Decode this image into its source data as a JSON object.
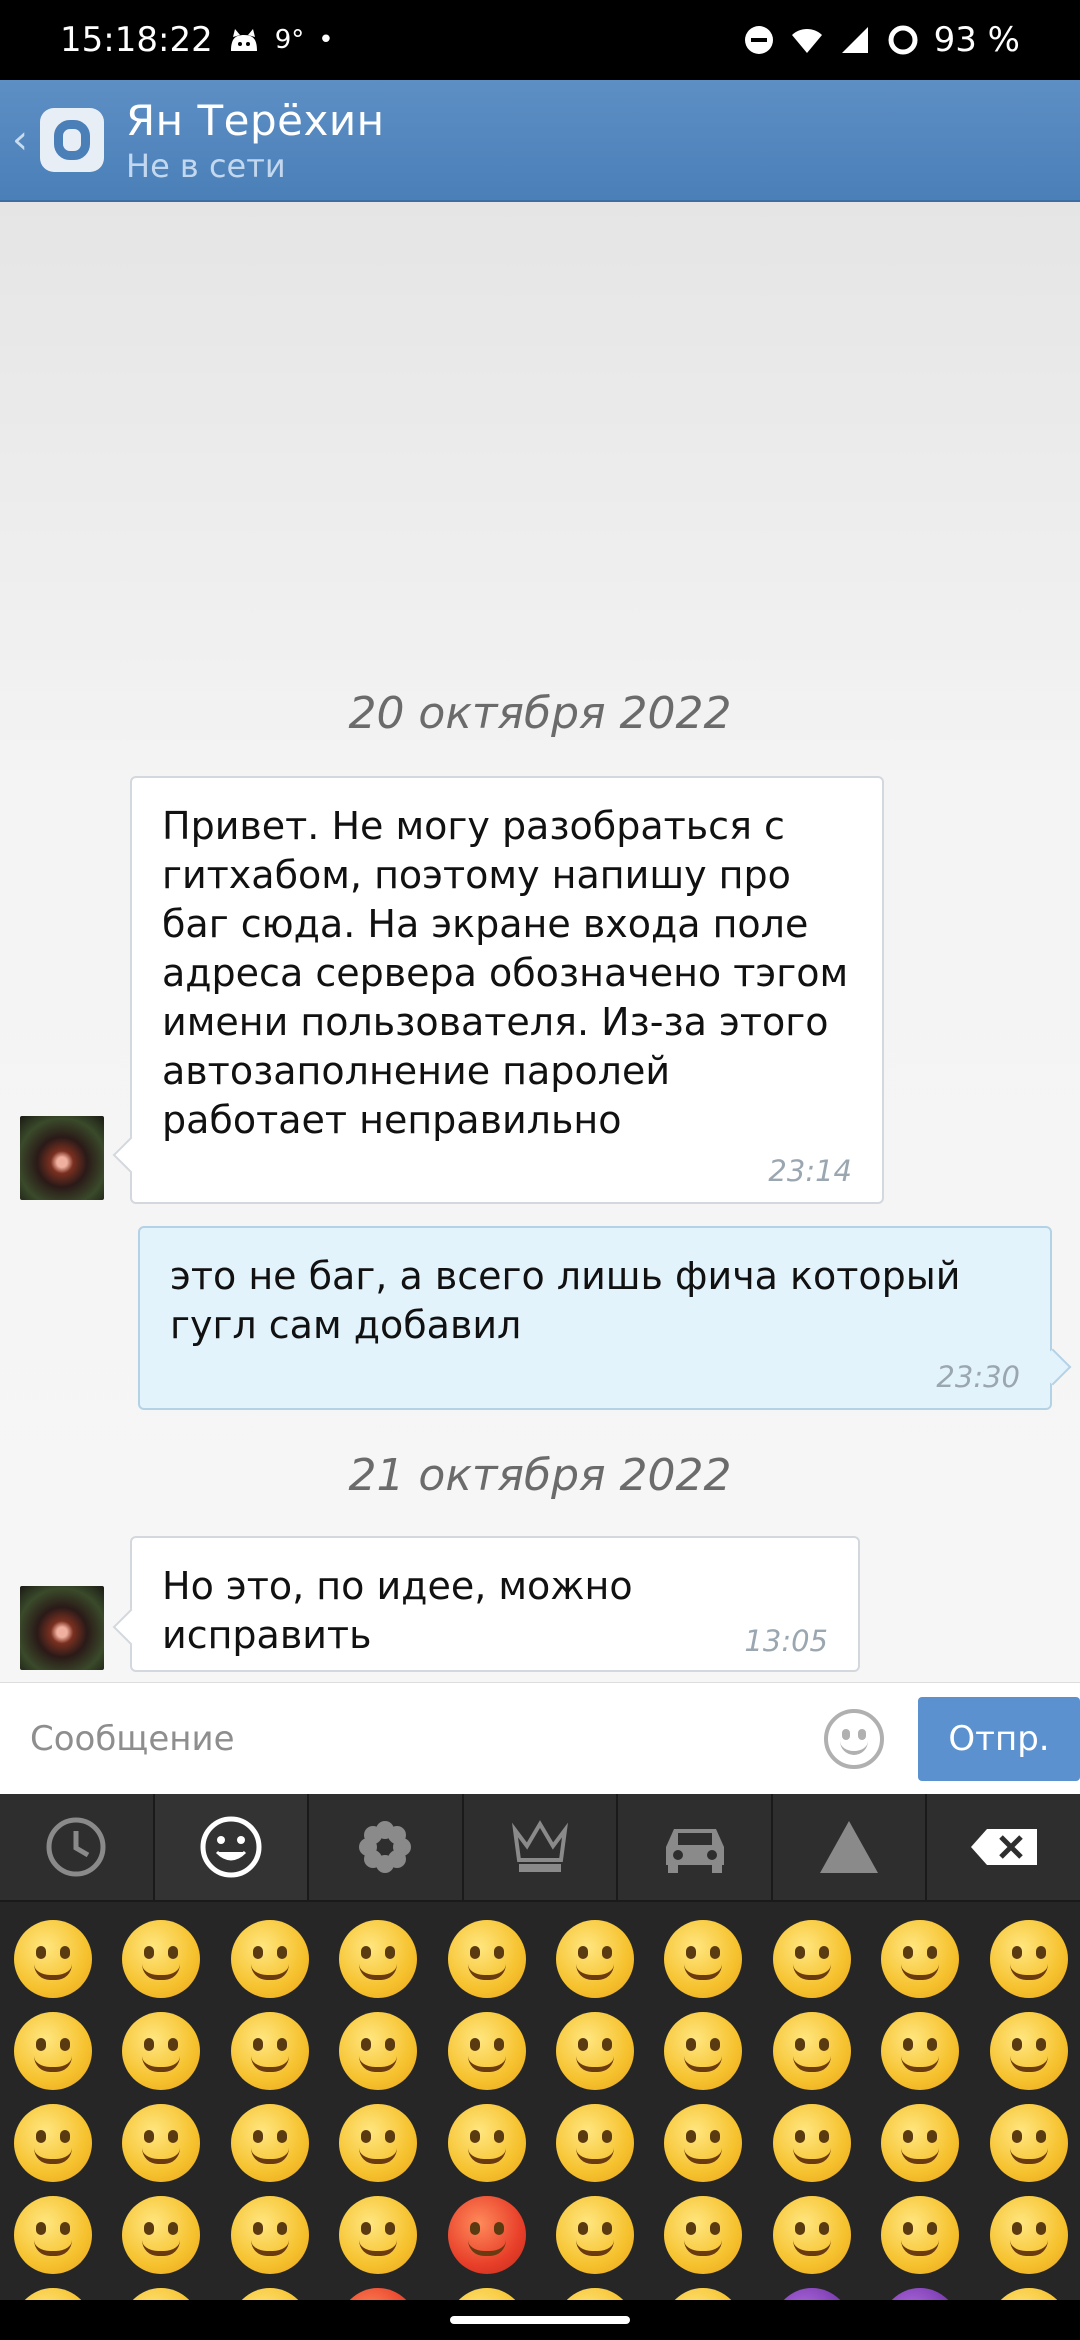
{
  "status_bar": {
    "time": "15:18:22",
    "temperature": "9°",
    "dot": "•",
    "battery": "93 %",
    "icons": [
      "cat-icon",
      "dnd-icon",
      "wifi-icon",
      "signal-icon",
      "battery-ring-icon"
    ]
  },
  "header": {
    "name": "Ян Терёхин",
    "status": "Не в сети",
    "back_glyph": "‹"
  },
  "chat": {
    "date1": "20 октября 2022",
    "date2": "21 октября 2022",
    "messages": [
      {
        "direction": "in",
        "text": "Привет. Не могу разобраться с гитхабом, поэтому напишу про баг сюда. На экране входа поле адреса сервера обозначено тэгом имени пользователя. Из-за этого автозаполнение паролей работает неправильно",
        "time": "23:14"
      },
      {
        "direction": "out",
        "text": "это не баг, а всего лишь фича который гугл сам добавил",
        "time": "23:30"
      },
      {
        "direction": "in",
        "text": "Но это, по идее, можно исправить",
        "time": "13:05"
      }
    ]
  },
  "input": {
    "placeholder": "Сообщение",
    "value": "",
    "send_label": "Отпр."
  },
  "keyboard": {
    "tabs": [
      "recent-icon",
      "smiley-icon",
      "flower-icon",
      "crown-icon",
      "car-icon",
      "triangle-icon",
      "backspace-icon"
    ],
    "active_tab": 1
  },
  "colors": {
    "header": "#4a7fb8",
    "outgoing_bubble": "#e3f3fc",
    "send_button": "#5b91cf"
  }
}
